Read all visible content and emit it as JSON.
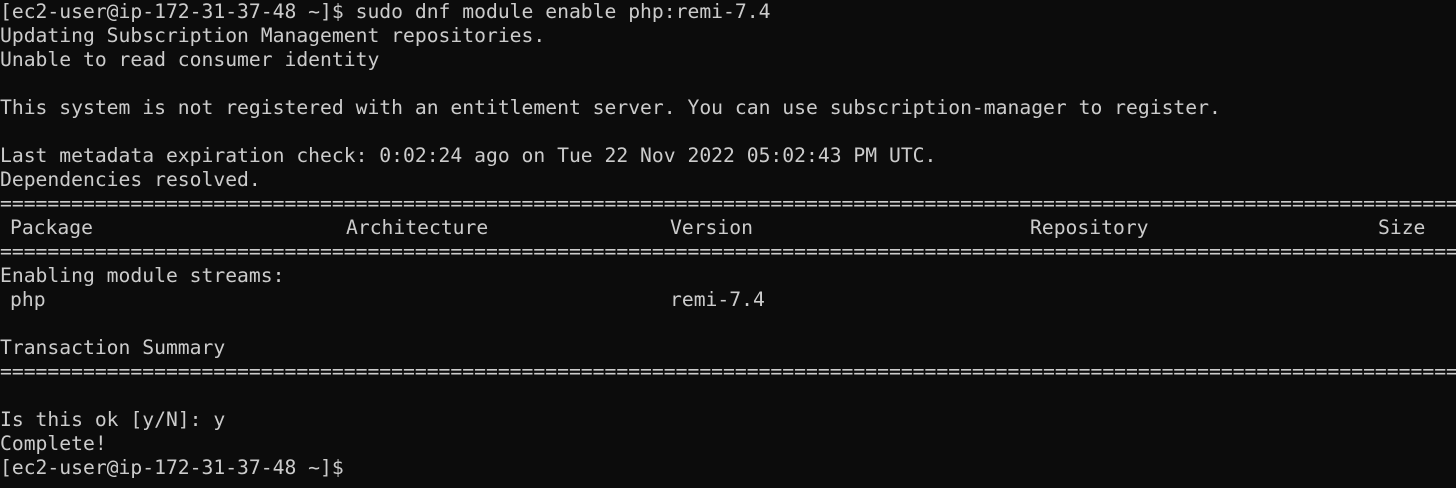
{
  "terminal": {
    "lines": {
      "l1": "[ec2-user@ip-172-31-37-48 ~]$ sudo dnf module enable php:remi-7.4",
      "l2": "Updating Subscription Management repositories.",
      "l3": "Unable to read consumer identity",
      "l5": "This system is not registered with an entitlement server. You can use subscription-manager to register.",
      "l7": "Last metadata expiration check: 0:02:24 ago on Tue 22 Nov 2022 05:02:43 PM UTC.",
      "l8": "Dependencies resolved.",
      "l11": "Enabling module streams:",
      "l14": "Transaction Summary",
      "l17": "Is this ok [y/N]: y",
      "l18": "Complete!",
      "l19": "[ec2-user@ip-172-31-37-48 ~]$"
    },
    "table": {
      "columns": [
        "Package",
        "Architecture",
        "Version",
        "Repository",
        "Size"
      ],
      "rows": [
        {
          "package": "php",
          "version": "remi-7.4"
        }
      ]
    },
    "rule": "============================================================================================================================================================"
  }
}
